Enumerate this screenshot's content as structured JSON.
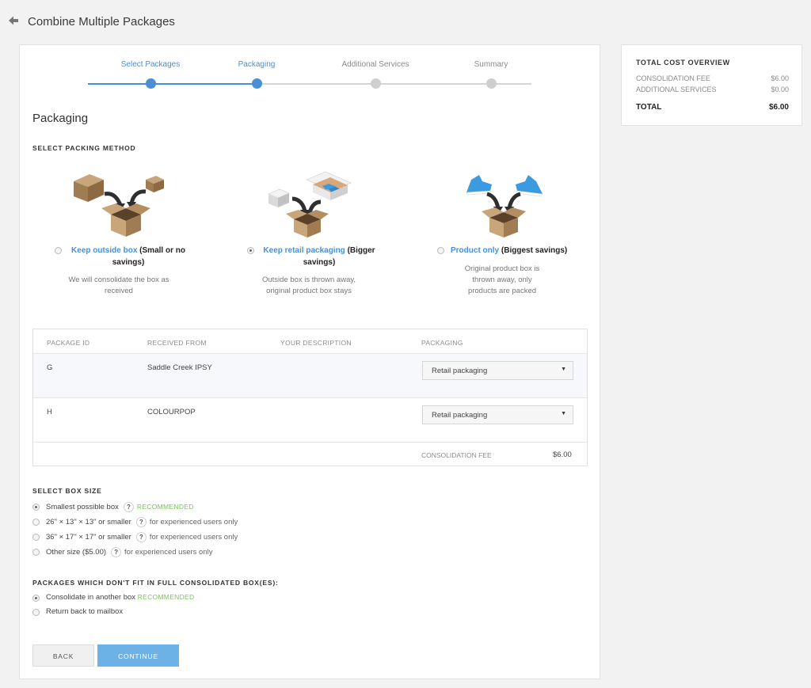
{
  "header": {
    "title": "Combine Multiple Packages",
    "back_icon": "arrow-left-icon"
  },
  "stepper": {
    "steps": [
      {
        "label": "Select Packages",
        "state": "done"
      },
      {
        "label": "Packaging",
        "state": "active"
      },
      {
        "label": "Additional Services",
        "state": "pending"
      },
      {
        "label": "Summary",
        "state": "pending"
      }
    ],
    "colors": {
      "active": "#4a8fd6",
      "pending": "#c8c8c8",
      "pending_text": "#8a8a8a"
    }
  },
  "section_title": "Packaging",
  "packing": {
    "heading": "SELECT PACKING METHOD",
    "options": [
      {
        "link": "Keep outside box",
        "rest": "(Small or no savings)",
        "desc": "We will consolidate the box as received",
        "selected": false,
        "illustration": "box-into-box-illustration"
      },
      {
        "link": "Keep retail packaging",
        "rest": "(Bigger savings)",
        "desc": "Outside box is thrown away, original product box stays",
        "selected": true,
        "illustration": "retail-box-illustration"
      },
      {
        "link": "Product only",
        "rest": "(Biggest savings)",
        "desc": "Original product box is thrown away, only products are packed",
        "selected": false,
        "illustration": "sneakers-illustration"
      }
    ]
  },
  "table": {
    "headers": [
      "PACKAGE ID",
      "RECEIVED FROM",
      "YOUR DESCRIPTION",
      "PACKAGING"
    ],
    "rows": [
      {
        "id": "G",
        "from": "Saddle Creek IPSY",
        "description": "",
        "packaging": "Retail packaging"
      },
      {
        "id": "H",
        "from": "COLOURPOP",
        "description": "",
        "packaging": "Retail packaging"
      }
    ],
    "fee_label": "CONSOLIDATION FEE",
    "fee_value": "$6.00"
  },
  "box_size": {
    "heading": "SELECT BOX SIZE",
    "options": [
      {
        "label": "Smallest possible box",
        "note": "RECOMMENDED",
        "note_type": "recommended",
        "selected": true
      },
      {
        "label": "26\" × 13\" × 13\" or smaller",
        "note": "for experienced users only",
        "note_type": "experienced",
        "selected": false
      },
      {
        "label": "36\" × 17\" × 17\" or smaller",
        "note": "for experienced users only",
        "note_type": "experienced",
        "selected": false
      },
      {
        "label": "Other size ($5.00)",
        "note": "for experienced users only",
        "note_type": "experienced",
        "selected": false
      }
    ]
  },
  "overflow": {
    "heading": "PACKAGES WHICH DON'T FIT IN FULL CONSOLIDATED BOX(ES):",
    "options": [
      {
        "label": "Consolidate in another box",
        "note": "RECOMMENDED",
        "selected": true
      },
      {
        "label": "Return back to mailbox",
        "note": "",
        "selected": false
      }
    ]
  },
  "buttons": {
    "back": "BACK",
    "continue": "CONTINUE"
  },
  "summary": {
    "title": "TOTAL COST OVERVIEW",
    "lines": [
      {
        "label": "CONSOLIDATION FEE",
        "value": "$6.00"
      },
      {
        "label": "ADDITIONAL SERVICES",
        "value": "$0.00"
      }
    ],
    "total_label": "TOTAL",
    "total_value": "$6.00"
  },
  "colors": {
    "accent": "#4a8fd6",
    "button": "#6cb2e6",
    "recommended": "#7cc35a"
  }
}
